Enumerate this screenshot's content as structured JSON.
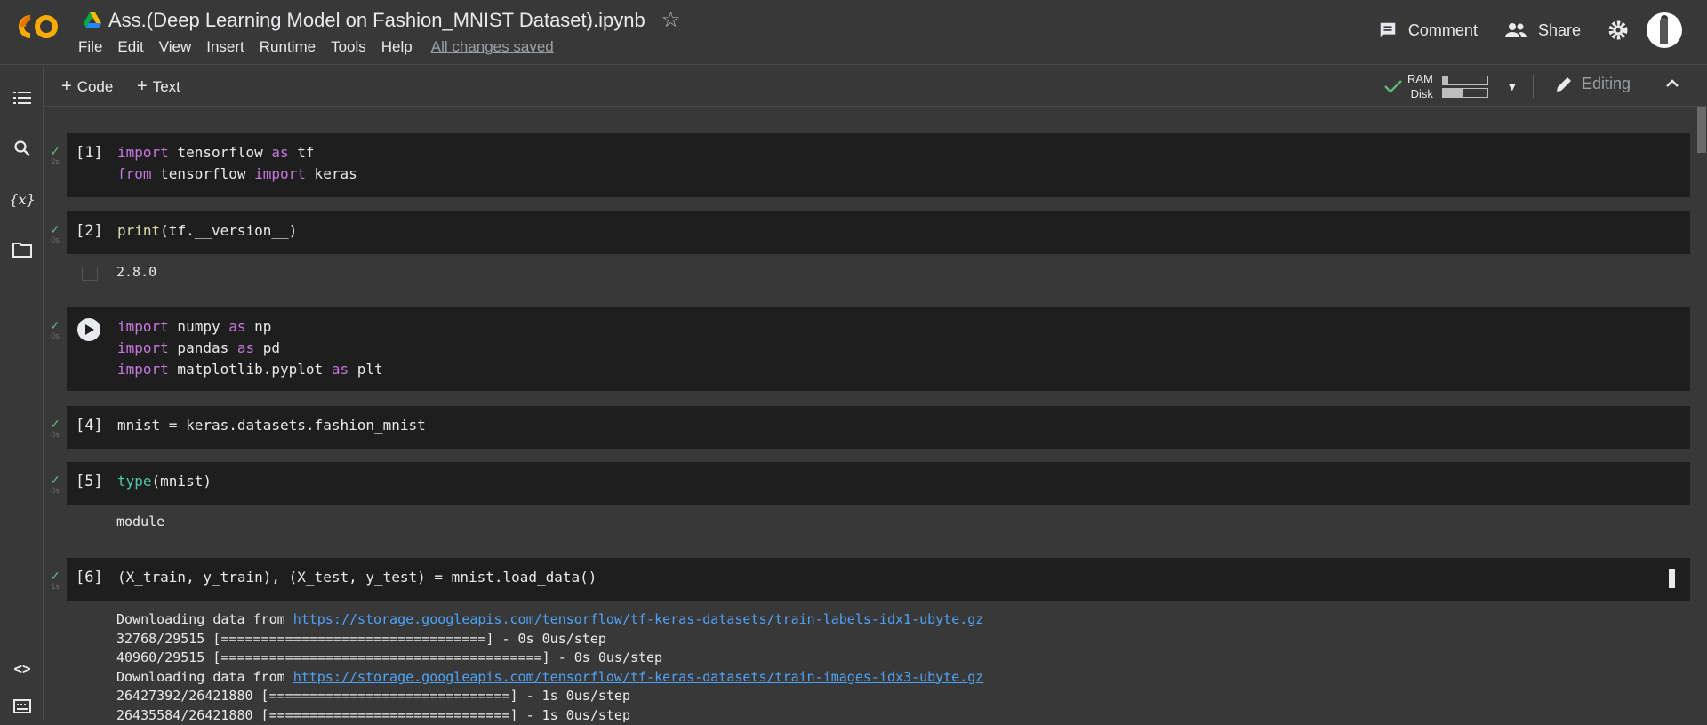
{
  "header": {
    "doc_title": "Ass.(Deep Learning Model on Fashion_MNIST Dataset).ipynb",
    "menu": [
      "File",
      "Edit",
      "View",
      "Insert",
      "Runtime",
      "Tools",
      "Help"
    ],
    "saved_status": "All changes saved",
    "comment_label": "Comment",
    "share_label": "Share"
  },
  "toolbar": {
    "add_code_label": "Code",
    "add_text_label": "Text",
    "ram_label": "RAM",
    "disk_label": "Disk",
    "ram_usage": 0.12,
    "disk_usage": 0.45,
    "editing_label": "Editing"
  },
  "colors": {
    "background": "#383838",
    "cell_bg": "#1e1e1e",
    "keyword": "#c678dd",
    "builtin": "#4ec9b0",
    "function": "#dcdcaa",
    "link": "#4fa3f7",
    "check": "#5bb974"
  },
  "cells": [
    {
      "exec": "[1]",
      "time": "2s",
      "lines": [
        "import tensorflow as tf",
        "from tensorflow import keras"
      ]
    },
    {
      "exec": "[2]",
      "time": "0s",
      "lines": [
        "print(tf.__version__)"
      ],
      "output": "2.8.0"
    },
    {
      "exec": "",
      "time": "0s",
      "lines": [
        "import numpy as np",
        "import pandas as pd",
        "import matplotlib.pyplot as plt"
      ]
    },
    {
      "exec": "[4]",
      "time": "0s",
      "lines": [
        "mnist = keras.datasets.fashion_mnist"
      ]
    },
    {
      "exec": "[5]",
      "time": "0s",
      "lines": [
        "type(mnist)"
      ],
      "output": "module"
    },
    {
      "exec": "[6]",
      "time": "1s",
      "lines": [
        "(X_train, y_train), (X_test, y_test) = mnist.load_data()"
      ]
    }
  ],
  "output6": {
    "dl_prefix": "Downloading data from ",
    "url1": "https://storage.googleapis.com/tensorflow/tf-keras-datasets/train-labels-idx1-ubyte.gz",
    "p1": "32768/29515 [=================================] - 0s 0us/step",
    "p2": "40960/29515 [========================================] - 0s 0us/step",
    "url2": "https://storage.googleapis.com/tensorflow/tf-keras-datasets/train-images-idx3-ubyte.gz",
    "p3": "26427392/26421880 [==============================] - 1s 0us/step",
    "p4": "26435584/26421880 [==============================] - 1s 0us/step"
  }
}
